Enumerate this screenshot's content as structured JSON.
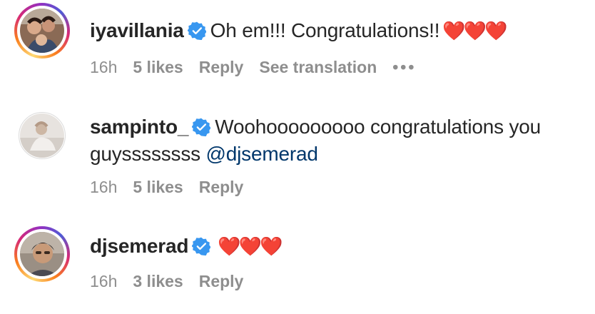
{
  "comments": [
    {
      "username": "iyavillania",
      "text": "Oh em!!! Congratulations!!",
      "emoji": "❤️❤️❤️",
      "time": "16h",
      "likes": "5 likes",
      "reply": "Reply",
      "translation": "See translation",
      "more": "•••"
    },
    {
      "username": "sampinto_",
      "text": "Woohooooooooo congratulations you guyssssssss",
      "mention": "@djsemerad",
      "time": "16h",
      "likes": "5 likes",
      "reply": "Reply"
    },
    {
      "username": "djsemerad",
      "emoji": "❤️❤️❤️",
      "time": "16h",
      "likes": "3 likes",
      "reply": "Reply"
    }
  ],
  "colors": {
    "verified": "#3897f0",
    "mention": "#00376b",
    "meta": "#8e8e8e",
    "heart": "#ed1c24"
  }
}
